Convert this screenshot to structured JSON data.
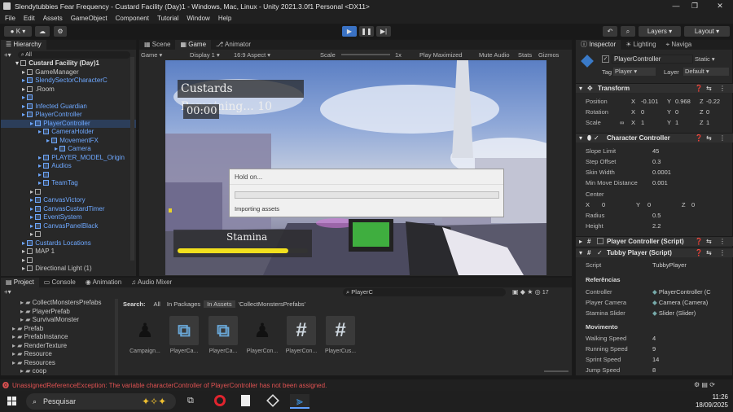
{
  "window": {
    "title": "Slendytubbies Fear Frequency - Custard Facility (Day)1 - Windows, Mac, Linux - Unity 2021.3.0f1 Personal <DX11>",
    "minimize": "—",
    "maximize": "❐",
    "close": "✕"
  },
  "menu": [
    "File",
    "Edit",
    "Assets",
    "GameObject",
    "Component",
    "Tutorial",
    "Window",
    "Help"
  ],
  "toolbar": {
    "account": "K",
    "layers": "Layers",
    "layout": "Layout"
  },
  "hierarchy": {
    "tab": "Hierarchy",
    "search_placeholder": "All",
    "scene": "Custard Facility (Day)1",
    "items": [
      {
        "label": "GameManager",
        "indent": 2,
        "blue": false
      },
      {
        "label": "SlendySectorCharacterC",
        "indent": 2,
        "blue": true
      },
      {
        "label": ".Room",
        "indent": 2,
        "blue": false
      },
      {
        "label": "",
        "indent": 2,
        "blue": true
      },
      {
        "label": "Infected Guardian",
        "indent": 2,
        "blue": true
      },
      {
        "label": "PlayerController",
        "indent": 2,
        "blue": true
      },
      {
        "label": "PlayerController",
        "indent": 3,
        "blue": true
      },
      {
        "label": "CameraHolder",
        "indent": 4,
        "blue": true
      },
      {
        "label": "MovementFX",
        "indent": 5,
        "blue": true
      },
      {
        "label": "Camera",
        "indent": 6,
        "blue": true
      },
      {
        "label": "PLAYER_MODEL_Origin",
        "indent": 4,
        "blue": true
      },
      {
        "label": "Audios",
        "indent": 4,
        "blue": true
      },
      {
        "label": "",
        "indent": 4,
        "blue": true
      },
      {
        "label": "TeamTag",
        "indent": 4,
        "blue": true
      },
      {
        "label": "",
        "indent": 3,
        "blue": false
      },
      {
        "label": "CanvasVictory",
        "indent": 3,
        "blue": true
      },
      {
        "label": "CanvasCustardTimer",
        "indent": 3,
        "blue": true
      },
      {
        "label": "EventSystem",
        "indent": 3,
        "blue": true
      },
      {
        "label": "CanvasPanelBlack",
        "indent": 3,
        "blue": true
      },
      {
        "label": "",
        "indent": 3,
        "blue": false
      },
      {
        "label": "Custards Locations",
        "indent": 2,
        "blue": true
      },
      {
        "label": "MAP 1",
        "indent": 2,
        "blue": false
      },
      {
        "label": "",
        "indent": 2,
        "blue": false
      },
      {
        "label": "Directional Light (1)",
        "indent": 2,
        "blue": false
      }
    ]
  },
  "scene_tabs": [
    "Scene",
    "Game",
    "Animator"
  ],
  "game_bar": {
    "mode": "Game",
    "display": "Display 1",
    "aspect": "16:9 Aspect",
    "scale_label": "Scale",
    "scale_value": "1x",
    "play_maximized": "Play Maximized",
    "mute": "Mute Audio",
    "stats": "Stats",
    "gizmos": "Gizmos"
  },
  "game": {
    "custards_remaining": "Custards Remaining... 10",
    "timer": "00:00",
    "stamina": "Stamina",
    "stamina_fraction": 0.85
  },
  "dialog": {
    "title": "Hold on...",
    "message": "Importing assets"
  },
  "inspector": {
    "tabs": [
      "Inspector",
      "Lighting",
      "Naviga"
    ],
    "object_name": "PlayerController",
    "static_label": "Static",
    "tag_label": "Tag",
    "tag_value": "Player",
    "layer_label": "Layer",
    "layer_value": "Default",
    "transform": {
      "title": "Transform",
      "position": {
        "label": "Position",
        "x": "-0.101",
        "y": "0.968",
        "z": "-0.22"
      },
      "rotation": {
        "label": "Rotation",
        "x": "0",
        "y": "0",
        "z": "0"
      },
      "scale": {
        "label": "Scale",
        "x": "1",
        "y": "1",
        "z": "1"
      }
    },
    "character_controller": {
      "title": "Character Controller",
      "fields": [
        {
          "label": "Slope Limit",
          "value": "45"
        },
        {
          "label": "Step Offset",
          "value": "0.3"
        },
        {
          "label": "Skin Width",
          "value": "0.0001"
        },
        {
          "label": "Min Move Distance",
          "value": "0.001"
        }
      ],
      "center_label": "Center",
      "center": {
        "x": "0",
        "y": "0",
        "z": "0"
      },
      "radius": {
        "label": "Radius",
        "value": "0.5"
      },
      "height": {
        "label": "Height",
        "value": "2.2"
      }
    },
    "player_controller_script": "Player Controller (Script)",
    "tubby_player_script": "Tubby Player (Script)",
    "script_label": "Script",
    "script_value": "TubbyPlayer",
    "referencias": "Referências",
    "refs": [
      {
        "label": "Controller",
        "value": "PlayerController (C"
      },
      {
        "label": "Player Camera",
        "value": "Camera (Camera)"
      },
      {
        "label": "Stamina Slider",
        "value": "Slider (Slider)"
      }
    ],
    "movimento": "Movimento",
    "moves": [
      {
        "label": "Walking Speed",
        "value": "4"
      },
      {
        "label": "Running Speed",
        "value": "9"
      },
      {
        "label": "Sprint Speed",
        "value": "14"
      },
      {
        "label": "Jump Speed",
        "value": "8"
      }
    ]
  },
  "project": {
    "tabs": [
      "Project",
      "Console",
      "Animation",
      "Audio Mixer"
    ],
    "search_value": "PlayerC",
    "search_label": "Search:",
    "filters": [
      "All",
      "In Packages",
      "In Assets",
      "'CollectMonstersPrefabs'"
    ],
    "folders": [
      {
        "label": "CollectMonstersPrefabs",
        "indent": 2
      },
      {
        "label": "PlayerPrefab",
        "indent": 2
      },
      {
        "label": "SurvivalMonster",
        "indent": 2
      },
      {
        "label": "Prefab",
        "indent": 1
      },
      {
        "label": "PrefabInstance",
        "indent": 1
      },
      {
        "label": "RenderTexture",
        "indent": 1
      },
      {
        "label": "Resource",
        "indent": 1
      },
      {
        "label": "Resources",
        "indent": 1
      },
      {
        "label": "coop",
        "indent": 2
      }
    ],
    "assets": [
      {
        "label": "Campaign...",
        "icon": "figure"
      },
      {
        "label": "PlayerCa...",
        "icon": "prefab"
      },
      {
        "label": "PlayerCa...",
        "icon": "prefab"
      },
      {
        "label": "PlayerCon...",
        "icon": "figure"
      },
      {
        "label": "PlayerCon...",
        "icon": "script"
      },
      {
        "label": "PlayerCus...",
        "icon": "script"
      }
    ],
    "count": "17"
  },
  "status": {
    "message": "UnassignedReferenceException: The variable characterController of PlayerController has not been assigned."
  },
  "taskbar": {
    "search": "Pesquisar",
    "time": "11:26",
    "date": "18/09/2025"
  }
}
